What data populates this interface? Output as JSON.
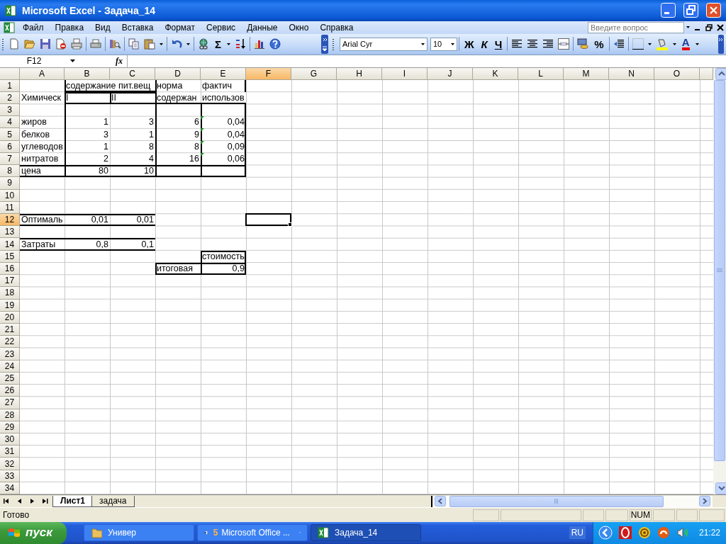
{
  "window": {
    "title": "Microsoft Excel - Задача_14"
  },
  "menu": {
    "items": [
      "Файл",
      "Правка",
      "Вид",
      "Вставка",
      "Формат",
      "Сервис",
      "Данные",
      "Окно",
      "Справка"
    ]
  },
  "help_box": {
    "placeholder": "Введите вопрос"
  },
  "standard_toolbar": {
    "autosum": "Σ"
  },
  "format_toolbar": {
    "font": "Arial Cyr",
    "size": "10",
    "bold": "Ж",
    "italic": "К",
    "underline": "Ч",
    "percent": "%",
    "font_color": "A"
  },
  "formula_bar": {
    "name_box": "F12",
    "function_label": "fx"
  },
  "sheet": {
    "columns": [
      {
        "label": "A",
        "selected": false
      },
      {
        "label": "B",
        "selected": false
      },
      {
        "label": "C",
        "selected": false
      },
      {
        "label": "D",
        "selected": false
      },
      {
        "label": "E",
        "selected": false
      },
      {
        "label": "F",
        "selected": true
      },
      {
        "label": "G",
        "selected": false
      },
      {
        "label": "H",
        "selected": false
      },
      {
        "label": "I",
        "selected": false
      },
      {
        "label": "J",
        "selected": false
      },
      {
        "label": "K",
        "selected": false
      },
      {
        "label": "L",
        "selected": false
      },
      {
        "label": "M",
        "selected": false
      },
      {
        "label": "N",
        "selected": false
      },
      {
        "label": "O",
        "selected": false
      }
    ],
    "rows": [
      {
        "label": "1",
        "selected": false,
        "cells": [
          {},
          {
            "text": "содержание пит.вещ",
            "kind": "text",
            "overflow": true,
            "borders": {
              "top": false,
              "right": false,
              "bottom": true,
              "left": true
            }
          },
          {
            "text": "норма",
            "kind": "text",
            "borders": {
              "top": false,
              "right": false,
              "bottom": false,
              "left": true
            }
          },
          {
            "text": "фактич",
            "kind": "text",
            "borders": {
              "top": false,
              "right": true,
              "bottom": false,
              "left": false
            }
          }
        ]
      },
      {
        "label": "2",
        "selected": false,
        "cells": [
          {
            "text": "Химическ",
            "kind": "text"
          },
          {
            "text": "I",
            "kind": "text",
            "borders": {
              "top": true,
              "right": false,
              "bottom": true,
              "left": true
            }
          },
          {
            "text": "II",
            "kind": "text",
            "borders": {
              "top": true,
              "right": false,
              "bottom": true,
              "left": true
            }
          },
          {
            "text": "содержан",
            "kind": "text",
            "borders": {
              "top": false,
              "right": false,
              "bottom": true,
              "left": true
            }
          },
          {
            "text": "использов",
            "kind": "text",
            "borders": {
              "top": false,
              "right": false,
              "bottom": true,
              "left": false
            }
          }
        ]
      },
      {
        "label": "3",
        "selected": false,
        "cells": [
          {},
          {
            "borders": {
              "top": false,
              "right": false,
              "bottom": false,
              "left": true
            }
          },
          {},
          {
            "borders": {
              "top": false,
              "right": false,
              "bottom": false,
              "left": true
            }
          },
          {
            "borders": {
              "top": false,
              "right": true,
              "bottom": false,
              "left": true
            }
          }
        ]
      },
      {
        "label": "4",
        "selected": false,
        "cells": [
          {
            "text": "жиров",
            "kind": "text"
          },
          {
            "text": "1",
            "kind": "number",
            "borders": {
              "top": false,
              "right": false,
              "bottom": false,
              "left": true
            }
          },
          {
            "text": "3",
            "kind": "number"
          },
          {
            "text": "6",
            "kind": "number",
            "borders": {
              "top": false,
              "right": false,
              "bottom": false,
              "left": true
            }
          },
          {
            "text": "0,04",
            "kind": "number",
            "flag": true,
            "borders": {
              "top": false,
              "right": true,
              "bottom": false,
              "left": true
            }
          }
        ]
      },
      {
        "label": "5",
        "selected": false,
        "cells": [
          {
            "text": "белков",
            "kind": "text"
          },
          {
            "text": "3",
            "kind": "number",
            "borders": {
              "top": false,
              "right": false,
              "bottom": false,
              "left": true
            }
          },
          {
            "text": "1",
            "kind": "number"
          },
          {
            "text": "9",
            "kind": "number",
            "borders": {
              "top": false,
              "right": false,
              "bottom": false,
              "left": true
            }
          },
          {
            "text": "0,04",
            "kind": "number",
            "flag": true,
            "borders": {
              "top": false,
              "right": true,
              "bottom": false,
              "left": true
            }
          }
        ]
      },
      {
        "label": "6",
        "selected": false,
        "cells": [
          {
            "text": "углеводов",
            "kind": "text"
          },
          {
            "text": "1",
            "kind": "number",
            "borders": {
              "top": false,
              "right": false,
              "bottom": false,
              "left": true
            }
          },
          {
            "text": "8",
            "kind": "number"
          },
          {
            "text": "8",
            "kind": "number",
            "borders": {
              "top": false,
              "right": false,
              "bottom": false,
              "left": true
            }
          },
          {
            "text": "0,09",
            "kind": "number",
            "flag": true,
            "borders": {
              "top": false,
              "right": true,
              "bottom": false,
              "left": true
            }
          }
        ]
      },
      {
        "label": "7",
        "selected": false,
        "cells": [
          {
            "text": "нитратов",
            "kind": "text"
          },
          {
            "text": "2",
            "kind": "number",
            "borders": {
              "top": false,
              "right": false,
              "bottom": false,
              "left": true
            }
          },
          {
            "text": "4",
            "kind": "number"
          },
          {
            "text": "16",
            "kind": "number",
            "borders": {
              "top": false,
              "right": false,
              "bottom": false,
              "left": true
            }
          },
          {
            "text": "0,06",
            "kind": "number",
            "flag": true,
            "borders": {
              "top": false,
              "right": true,
              "bottom": false,
              "left": true
            }
          }
        ]
      },
      {
        "label": "8",
        "selected": false,
        "cells": [
          {
            "text": "цена",
            "kind": "text",
            "borders": {
              "top": true,
              "right": false,
              "bottom": true,
              "left": false
            }
          },
          {
            "text": "80",
            "kind": "number",
            "borders": {
              "top": true,
              "right": false,
              "bottom": true,
              "left": true
            }
          },
          {
            "text": "10",
            "kind": "number",
            "borders": {
              "top": true,
              "right": false,
              "bottom": true,
              "left": false
            }
          },
          {
            "borders": {
              "top": true,
              "right": false,
              "bottom": true,
              "left": true
            }
          },
          {
            "borders": {
              "top": true,
              "right": true,
              "bottom": true,
              "left": true
            }
          }
        ]
      },
      {
        "label": "9",
        "selected": false,
        "cells": []
      },
      {
        "label": "10",
        "selected": false,
        "cells": []
      },
      {
        "label": "11",
        "selected": false,
        "cells": []
      },
      {
        "label": "12",
        "selected": true,
        "cells": [
          {
            "text": "Оптималь",
            "kind": "text",
            "borders": {
              "top": true,
              "right": false,
              "bottom": true,
              "left": false
            }
          },
          {
            "text": "0,01",
            "kind": "number",
            "borders": {
              "top": true,
              "right": false,
              "bottom": true,
              "left": false
            }
          },
          {
            "text": "0,01",
            "kind": "number",
            "borders": {
              "top": true,
              "right": false,
              "bottom": true,
              "left": false
            }
          }
        ]
      },
      {
        "label": "13",
        "selected": false,
        "cells": []
      },
      {
        "label": "14",
        "selected": false,
        "cells": [
          {
            "text": "Затраты",
            "kind": "text",
            "borders": {
              "top": true,
              "right": false,
              "bottom": true,
              "left": false
            }
          },
          {
            "text": "0,8",
            "kind": "number",
            "borders": {
              "top": true,
              "right": false,
              "bottom": true,
              "left": false
            }
          },
          {
            "text": "0,1",
            "kind": "number",
            "borders": {
              "top": true,
              "right": false,
              "bottom": true,
              "left": false
            }
          }
        ]
      },
      {
        "label": "15",
        "selected": false,
        "cells": [
          {},
          {},
          {},
          {},
          {
            "text": "стоимость",
            "kind": "text",
            "borders": {
              "top": true,
              "right": true,
              "bottom": false,
              "left": true
            }
          }
        ]
      },
      {
        "label": "16",
        "selected": false,
        "cells": [
          {},
          {},
          {},
          {
            "text": "итоговая",
            "kind": "text",
            "borders": {
              "top": true,
              "right": false,
              "bottom": true,
              "left": true
            }
          },
          {
            "text": "0,9",
            "kind": "number",
            "borders": {
              "top": true,
              "right": true,
              "bottom": true,
              "left": true
            }
          }
        ]
      },
      {
        "label": "17",
        "selected": false,
        "cells": []
      },
      {
        "label": "18",
        "selected": false,
        "cells": []
      },
      {
        "label": "19",
        "selected": false,
        "cells": []
      },
      {
        "label": "20",
        "selected": false,
        "cells": []
      },
      {
        "label": "21",
        "selected": false,
        "cells": []
      },
      {
        "label": "22",
        "selected": false,
        "cells": []
      },
      {
        "label": "23",
        "selected": false,
        "cells": []
      },
      {
        "label": "24",
        "selected": false,
        "cells": []
      },
      {
        "label": "25",
        "selected": false,
        "cells": []
      },
      {
        "label": "26",
        "selected": false,
        "cells": []
      },
      {
        "label": "27",
        "selected": false,
        "cells": []
      },
      {
        "label": "28",
        "selected": false,
        "cells": []
      },
      {
        "label": "29",
        "selected": false,
        "cells": []
      },
      {
        "label": "30",
        "selected": false,
        "cells": []
      },
      {
        "label": "31",
        "selected": false,
        "cells": []
      },
      {
        "label": "32",
        "selected": false,
        "cells": []
      },
      {
        "label": "33",
        "selected": false,
        "cells": []
      },
      {
        "label": "34",
        "selected": false,
        "cells": []
      }
    ]
  },
  "sheet_tabs": [
    {
      "label": "Лист1",
      "selected": true
    },
    {
      "label": "задача",
      "selected": false
    }
  ],
  "status_bar": {
    "text": "Готово",
    "indicators": [
      "NUM"
    ]
  },
  "taskbar": {
    "start": "пуск",
    "tasks": [
      {
        "kind": "folder",
        "label": "Универ",
        "selected": false
      },
      {
        "kind": "word",
        "count": "5",
        "label": "Microsoft Office ...",
        "selected": false
      },
      {
        "kind": "excel",
        "label": "Задача_14",
        "selected": true
      }
    ],
    "language": "RU",
    "clock": "21:22"
  }
}
